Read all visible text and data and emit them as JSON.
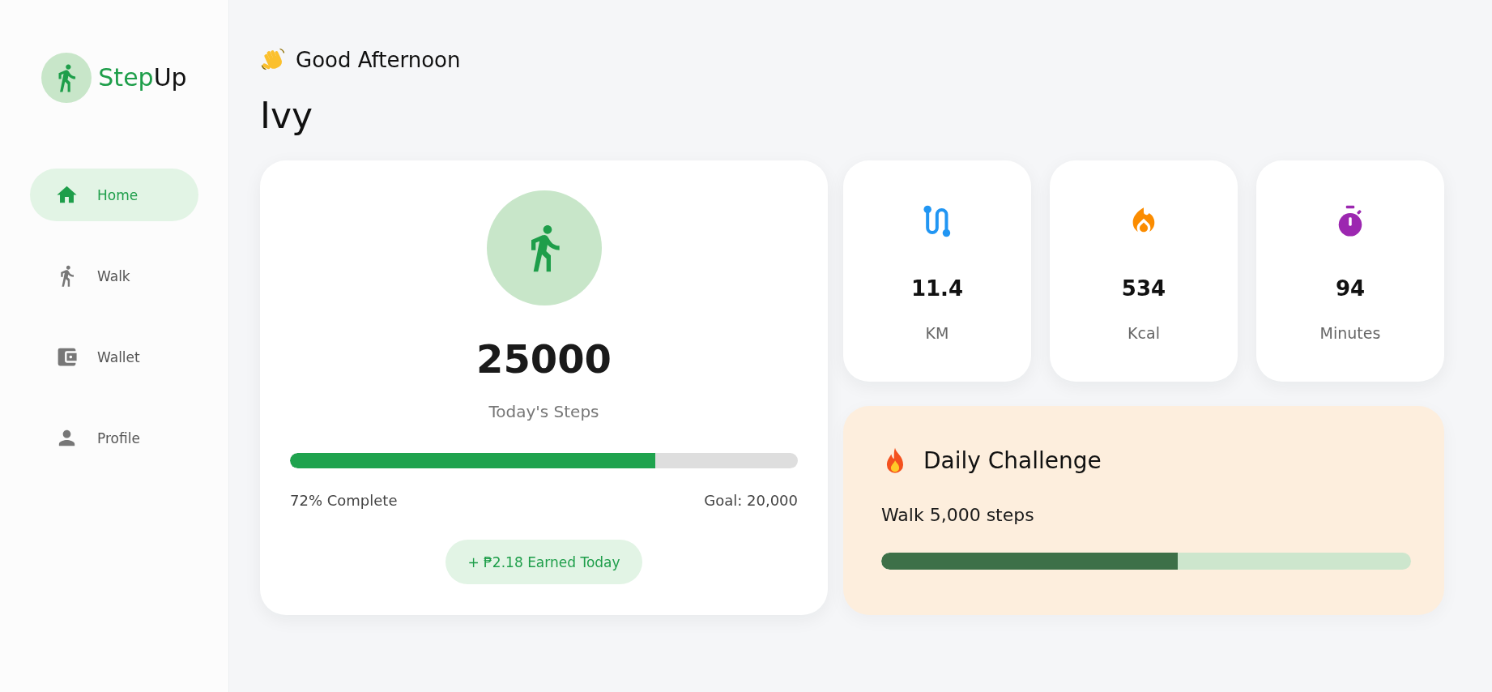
{
  "sidebar": {
    "brand": {
      "accent_part": "Step",
      "plain_part": "Up"
    },
    "nav": [
      {
        "kind": "home",
        "label": "Home",
        "selected": true
      },
      {
        "kind": "walk",
        "label": "Walk",
        "selected": false
      },
      {
        "kind": "wallet",
        "label": "Wallet",
        "selected": false
      },
      {
        "kind": "profile",
        "label": "Profile",
        "selected": false
      }
    ]
  },
  "header": {
    "greeting": "Good Afternoon",
    "name": "Ivy"
  },
  "steps_card": {
    "count": "25000",
    "label": "Today's Steps",
    "level": 0.72,
    "progress_text": "72% Complete",
    "goal": "Goal: 20,000",
    "earned": "+ ₱2.18 Earned Today"
  },
  "stats": [
    {
      "kind": "distance",
      "value": "11.4",
      "unit": "KM",
      "color": "#2196f3"
    },
    {
      "kind": "calories",
      "value": "534",
      "unit": "Kcal",
      "color": "#fb8c00"
    },
    {
      "kind": "time",
      "value": "94",
      "unit": "Minutes",
      "color": "#9c27b0"
    }
  ],
  "challenge": {
    "title": "Daily Challenge",
    "task": "Walk 5,000 steps",
    "level": 0.56
  }
}
